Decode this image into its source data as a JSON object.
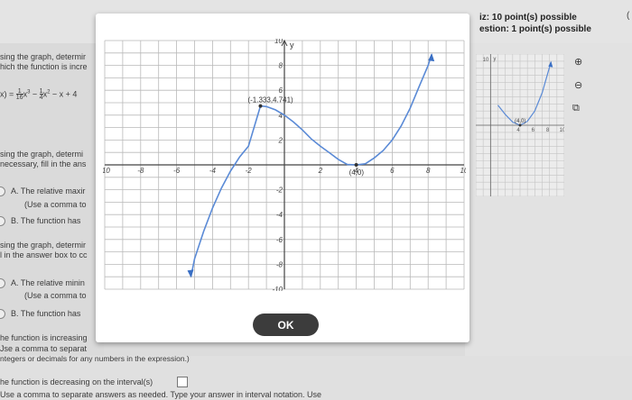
{
  "header": {
    "points_line": "iz: 10 point(s) possible",
    "question_line": "estion: 1 point(s) possible",
    "close_symbol": "✕"
  },
  "left_panel": {
    "line1": "sing the graph, determir",
    "line2": "hich the function is incre",
    "func_prefix": "x) = ",
    "frac1_num": "1",
    "frac1_den": "16",
    "term1": "x",
    "term1_exp": "3",
    "minus1": " − ",
    "frac2_num": "1",
    "frac2_den": "4",
    "term2": "x",
    "term2_exp": "2",
    "tail": " − x + 4",
    "section2_line1": "sing the graph, determi",
    "section2_line2": "necessary, fill in the ans",
    "optA_label": "A.",
    "optA_text": "The relative maxir",
    "optA_hint": "(Use a comma to",
    "optB_label": "B.",
    "optB_text": "The function has",
    "section3_line1": "sing the graph, determir",
    "section3_line2": "l in the answer box to cc",
    "optA2_label": "A.",
    "optA2_text": "The relative minin",
    "optA2_hint": "(Use a comma to",
    "optB2_label": "B.",
    "optB2_text": "The function has"
  },
  "bottom": {
    "inc_line": "he function is increasing",
    "inc_hint1": "Jse a comma to separat",
    "inc_hint2": "ntegers or decimals for any numbers in the expression.)",
    "dec_line": "he function is decreasing on the interval(s)",
    "dec_hint": "Use a comma to separate answers as needed. Type your answer in interval notation. Use"
  },
  "modal": {
    "ok_label": "OK"
  },
  "right_icons": {
    "zoom_in": "⊕",
    "zoom_out": "⊖",
    "popout": "⧉"
  },
  "chart_data": [
    {
      "type": "line",
      "title": "",
      "xlabel": "x",
      "ylabel": "y",
      "xlim": [
        -10,
        10
      ],
      "ylim": [
        -10,
        10
      ],
      "x_ticks": [
        -10,
        -8,
        -6,
        -4,
        -2,
        2,
        4,
        6,
        8,
        10
      ],
      "y_ticks": [
        -10,
        -8,
        -6,
        -4,
        -2,
        2,
        4,
        6,
        8,
        10
      ],
      "x_tick_labels": [
        "-10",
        "-8",
        "-6",
        "-4",
        "-2",
        "2",
        "4",
        "6",
        "8",
        "10"
      ],
      "y_tick_labels": [
        "-10",
        "-8",
        "-6",
        "-4",
        "-2",
        "2",
        "4",
        "6",
        "8",
        "10"
      ],
      "grid": true,
      "series": [
        {
          "x": [
            -5.2,
            -5,
            -4.5,
            -4,
            -3.5,
            -3,
            -2.5,
            -2,
            -1.333,
            -1,
            -0.5,
            0,
            0.5,
            1,
            1.5,
            2,
            2.5,
            3,
            3.5,
            4,
            4.5,
            5,
            5.5,
            6,
            6.5,
            7,
            7.5,
            8,
            8.2
          ],
          "y": [
            -9.0,
            -7.56,
            -5.36,
            -3.47,
            -1.86,
            -0.5,
            0.62,
            1.5,
            4.741,
            4.69,
            4.43,
            4.0,
            3.45,
            2.81,
            2.09,
            1.5,
            0.98,
            0.44,
            0.03,
            0.0,
            0.09,
            0.56,
            1.15,
            2.0,
            3.13,
            4.56,
            6.31,
            8.0,
            8.9
          ]
        }
      ],
      "points": [
        {
          "x": -1.333,
          "y": 4.741,
          "label": "(-1.333,4.741)"
        },
        {
          "x": 4,
          "y": 0,
          "label": "(4,0)"
        }
      ]
    },
    {
      "type": "line",
      "title": "",
      "xlabel": "x",
      "ylabel": "y",
      "xlim": [
        -10,
        10
      ],
      "ylim": [
        -10,
        10
      ],
      "x_tick_labels": [
        "4",
        "6",
        "8",
        "10"
      ],
      "y_tick_labels": [
        "10"
      ],
      "grid": true,
      "series": [
        {
          "x": [
            1,
            2,
            3,
            4,
            5,
            6,
            7,
            8.2
          ],
          "y": [
            2.81,
            1.5,
            0.44,
            0.0,
            0.56,
            2.0,
            4.56,
            8.9
          ]
        }
      ],
      "points": [
        {
          "x": 4,
          "y": 0,
          "label": "(4,0)"
        }
      ]
    }
  ]
}
